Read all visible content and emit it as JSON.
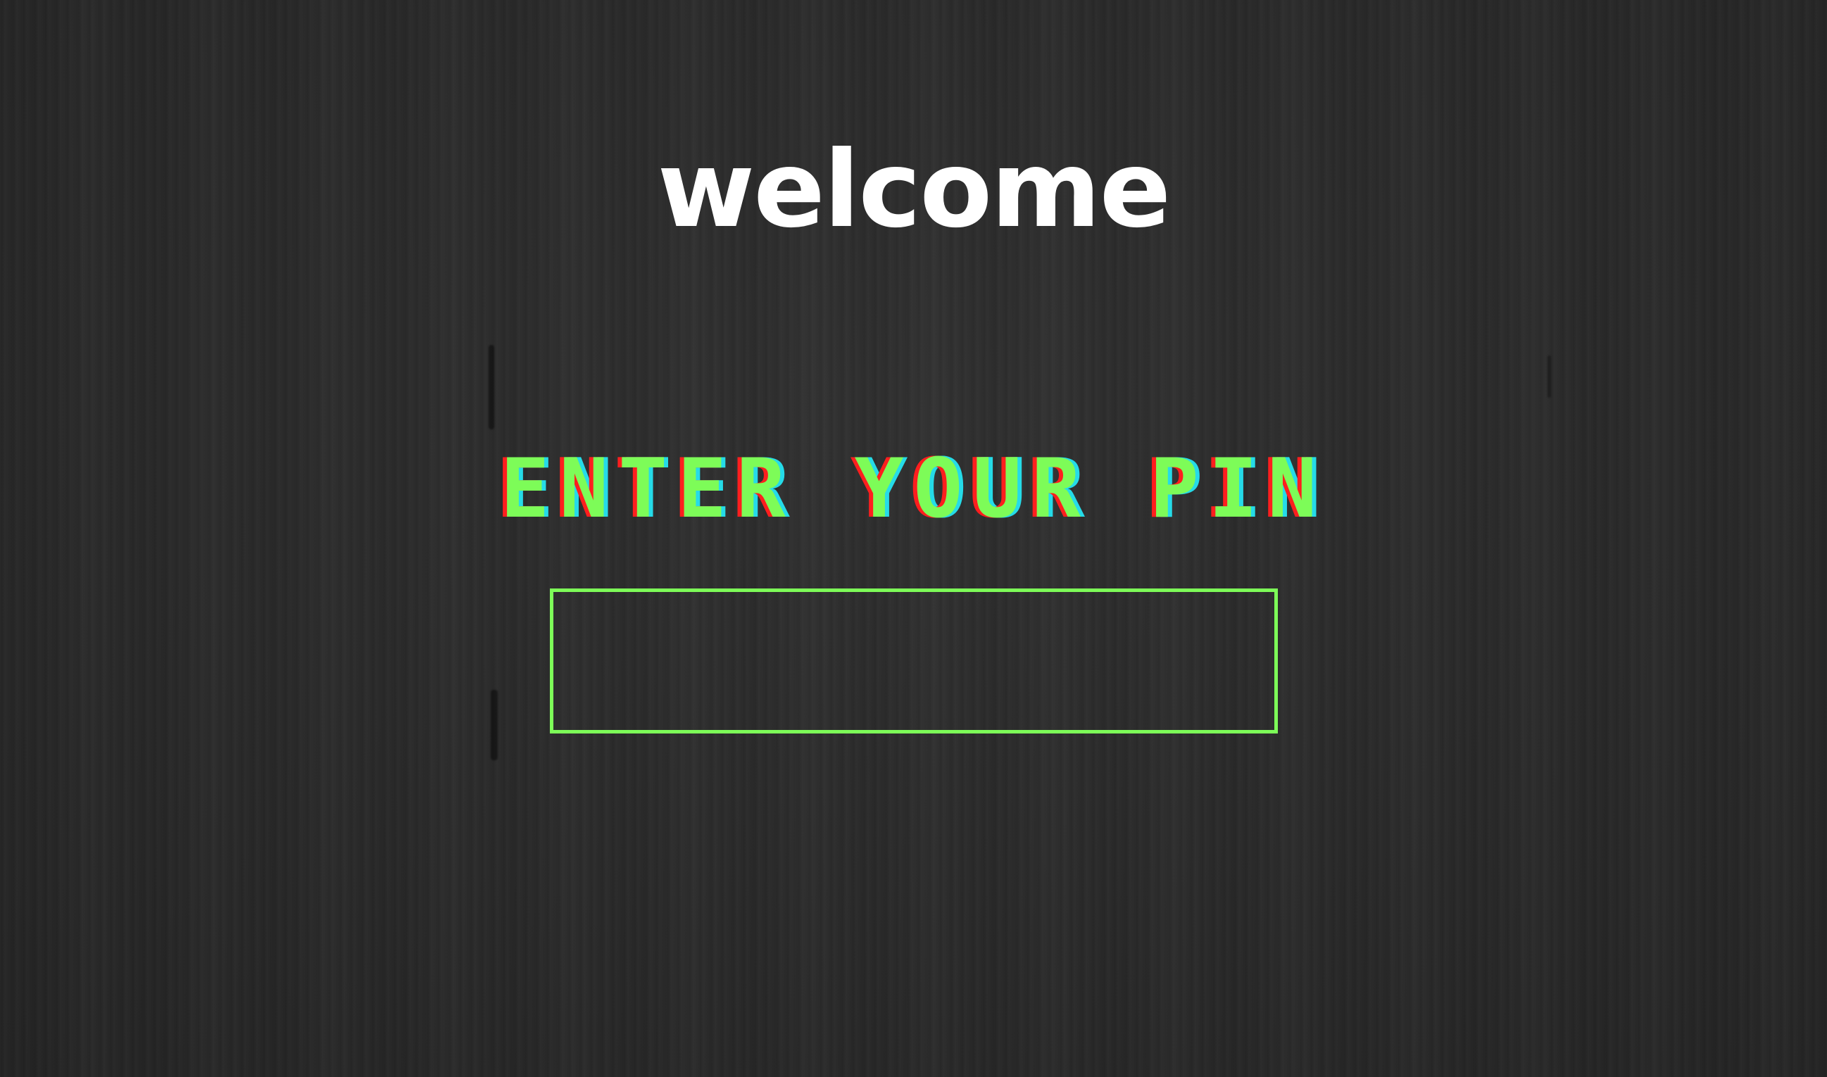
{
  "welcome": {
    "title": "welcome"
  },
  "pin_prompt": {
    "label": "ENTER YOUR PIN"
  },
  "pin_field": {
    "value": "",
    "placeholder": ""
  },
  "colors": {
    "background": "#2a2a2a",
    "title": "#ffffff",
    "accent_green": "#7dfc58",
    "glitch_red": "#ff1e1e",
    "glitch_cyan": "#25dbe8"
  }
}
